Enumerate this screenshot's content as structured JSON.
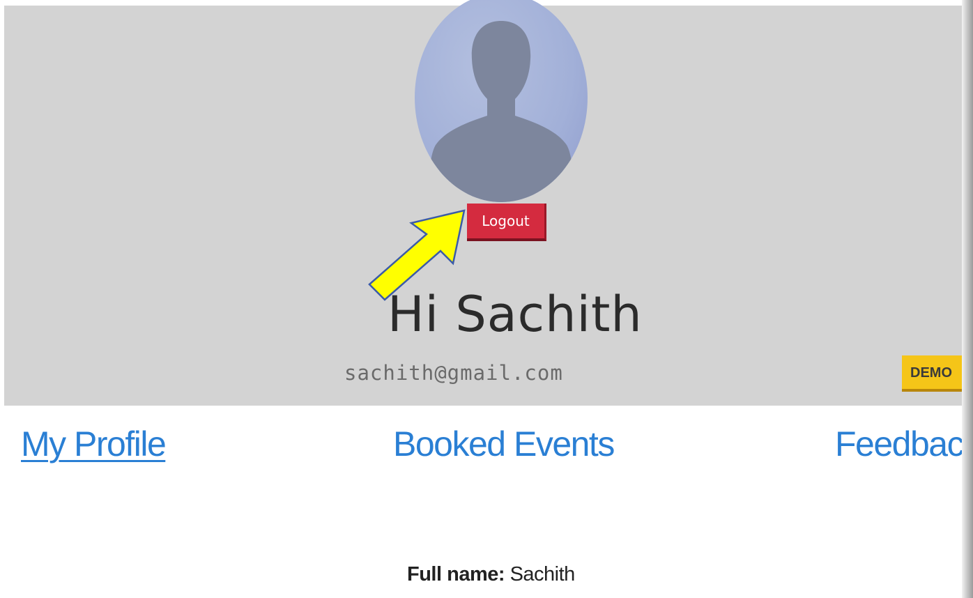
{
  "header": {
    "logout_label": "Logout",
    "greeting": "Hi Sachith",
    "email": "sachith@gmail.com",
    "badge_label": "DEMO"
  },
  "nav": {
    "items": [
      {
        "label": "My Profile",
        "active": true
      },
      {
        "label": "Booked Events",
        "active": false
      },
      {
        "label": "Feedback",
        "active": false
      }
    ]
  },
  "profile": {
    "full_name_label": "Full name:",
    "full_name_value": "Sachith"
  },
  "icons": {
    "avatar": "user-silhouette-icon",
    "annotation": "arrow-pointer-icon"
  },
  "colors": {
    "hero_bg": "#d3d3d3",
    "logout_bg": "#d42b3f",
    "badge_bg": "#f5c518",
    "link": "#2a7fd4",
    "arrow": "#ffff00"
  }
}
